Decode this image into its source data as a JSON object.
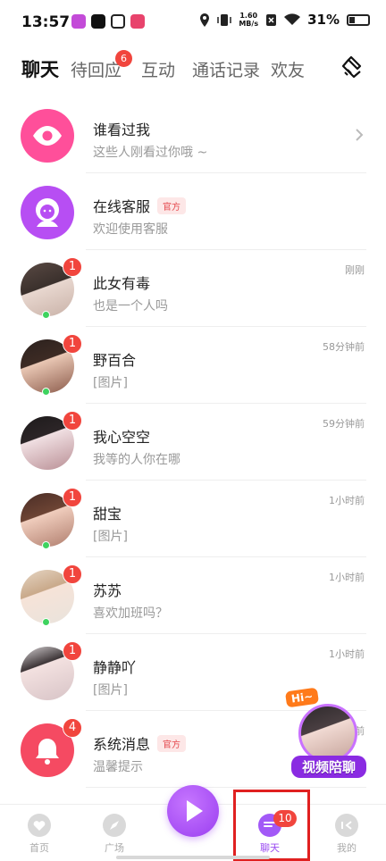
{
  "status_bar": {
    "time": "13:57",
    "speed_value": "1.60",
    "speed_unit": "MB/s",
    "battery": "31%"
  },
  "tabs": [
    {
      "label": "聊天",
      "active": true
    },
    {
      "label": "待回应",
      "badge": "6"
    },
    {
      "label": "互动"
    },
    {
      "label": "通话记录"
    },
    {
      "label": "欢友"
    }
  ],
  "rows": [
    {
      "title": "谁看过我",
      "subtitle": "这些人刚看过你哦 ~",
      "icon": "eye-icon",
      "color": "#ff4f9a"
    },
    {
      "title": "在线客服",
      "tag": "官方",
      "subtitle": "欢迎使用客服",
      "icon": "support-agent-icon",
      "color": "#b74ef3"
    },
    {
      "title": "此女有毒",
      "subtitle": "也是一个人吗",
      "time": "刚刚",
      "badge": "1",
      "online": true
    },
    {
      "title": "野百合",
      "subtitle": "[图片]",
      "time": "58分钟前",
      "badge": "1",
      "online": true
    },
    {
      "title": "我心空空",
      "subtitle": "我等的人你在哪",
      "time": "59分钟前",
      "badge": "1",
      "online": false
    },
    {
      "title": "甜宝",
      "subtitle": "[图片]",
      "time": "1小时前",
      "badge": "1",
      "online": true
    },
    {
      "title": "苏苏",
      "subtitle": "喜欢加班吗？",
      "time": "1小时前",
      "badge": "1",
      "online": true
    },
    {
      "title": "静静吖",
      "subtitle": "[图片]",
      "time": "1小时前",
      "badge": "1",
      "online": false
    },
    {
      "title": "系统消息",
      "tag": "官方",
      "subtitle": "温馨提示",
      "time": "前",
      "badge": "4",
      "icon": "bell-icon",
      "color": "#f54a62"
    }
  ],
  "video_widget": {
    "hi": "Hi~",
    "label": "视频陪聊"
  },
  "bottom_nav": {
    "home": "首页",
    "square": "广场",
    "chat": "聊天",
    "chat_badge": "10",
    "me": "我的"
  },
  "colors": {
    "accent": "#a259f7",
    "badge": "#f1453d",
    "online": "#3ed35f",
    "highlight": "#e02020"
  }
}
